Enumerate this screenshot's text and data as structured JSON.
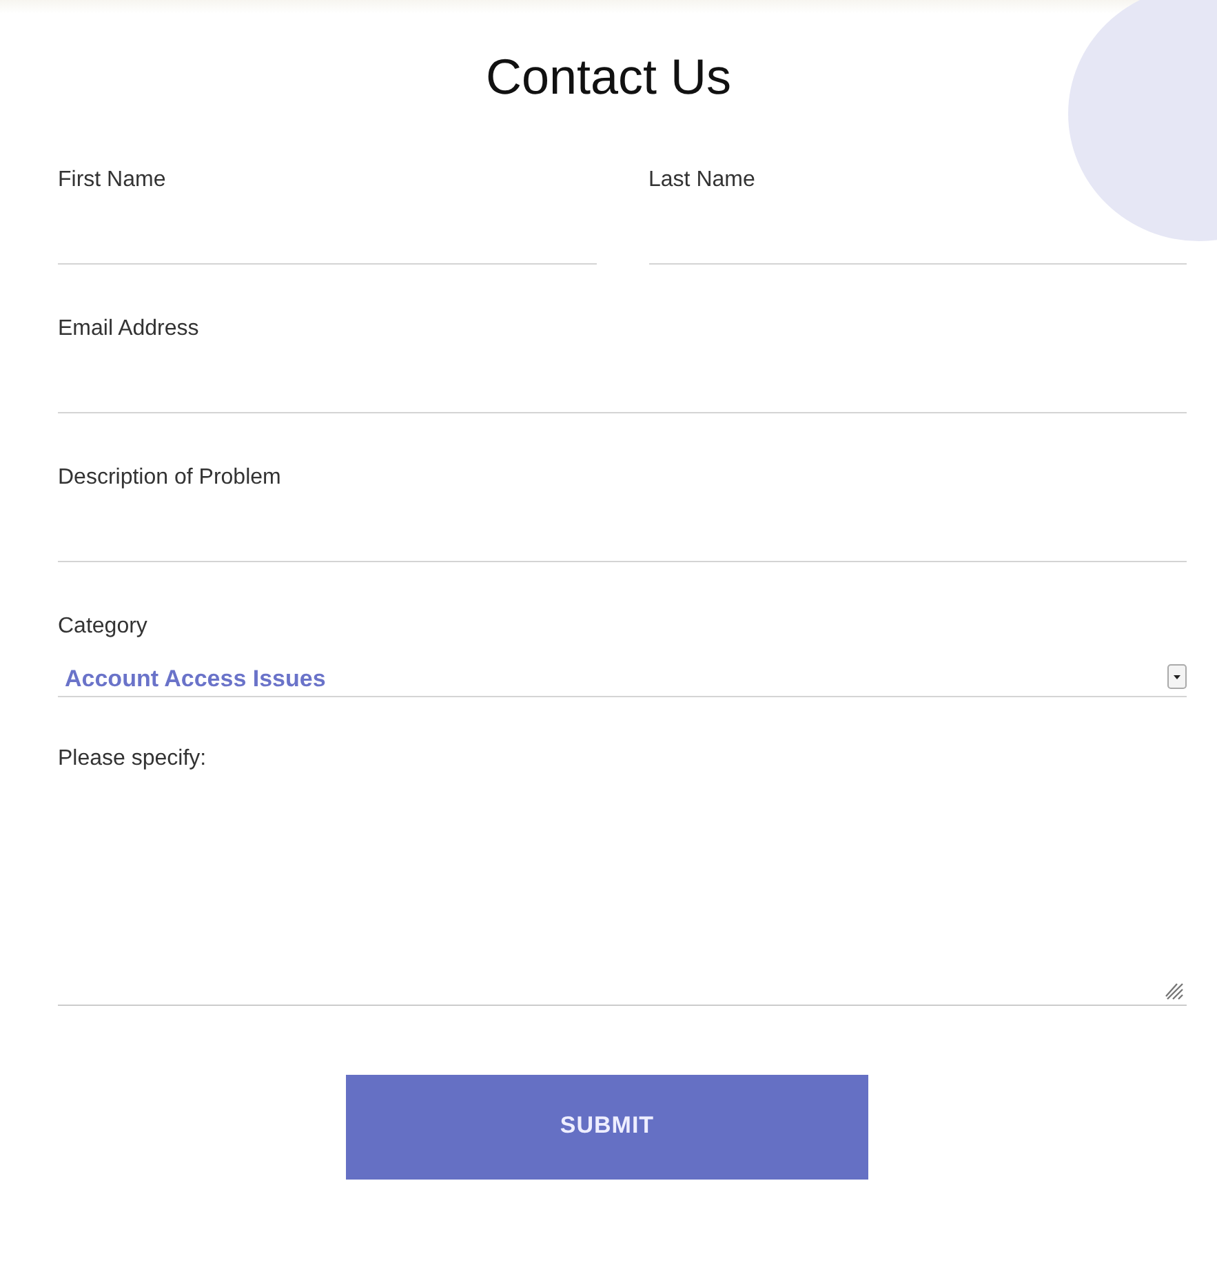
{
  "title": "Contact Us",
  "rows": [
    [
      {
        "kind": "text",
        "label": "First Name"
      },
      {
        "kind": "text",
        "label": "Last Name"
      }
    ],
    [
      {
        "kind": "text",
        "label": "Email Address"
      }
    ],
    [
      {
        "kind": "text",
        "label": "Description of Problem"
      }
    ],
    [
      {
        "kind": "select",
        "label": "Category",
        "value": "Account Access Issues"
      }
    ],
    [
      {
        "kind": "textarea",
        "label": "Please specify:"
      }
    ]
  ],
  "submit": "SUBMIT"
}
